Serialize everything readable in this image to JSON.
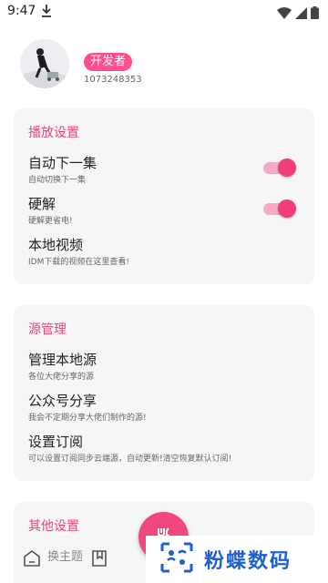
{
  "status_bar": {
    "time": "9:47"
  },
  "profile": {
    "badge": "开发者",
    "user_id": "1073248353"
  },
  "playback": {
    "title": "播放设置",
    "items": [
      {
        "title": "自动下一集",
        "subtitle": "自动切换下一集",
        "toggle": true
      },
      {
        "title": "硬解",
        "subtitle": "硬解更省电!",
        "toggle": true
      },
      {
        "title": "本地视频",
        "subtitle": "IDM下载的视频在这里查看!"
      }
    ]
  },
  "source": {
    "title": "源管理",
    "items": [
      {
        "title": "管理本地源",
        "subtitle": "各位大佬分享的源"
      },
      {
        "title": "公众号分享",
        "subtitle": "我会不定期分享大佬们制作的源!"
      },
      {
        "title": "设置订阅",
        "subtitle": "可以设置订阅同步云端源，自动更新!清空恢复默认订阅!"
      }
    ]
  },
  "other": {
    "title": "其他设置"
  },
  "overlay_label": "换主题",
  "watermark": {
    "text": "粉蝶数码"
  },
  "colors": {
    "accent": "#f0477c",
    "watermark_blue": "#1f5fcf"
  }
}
